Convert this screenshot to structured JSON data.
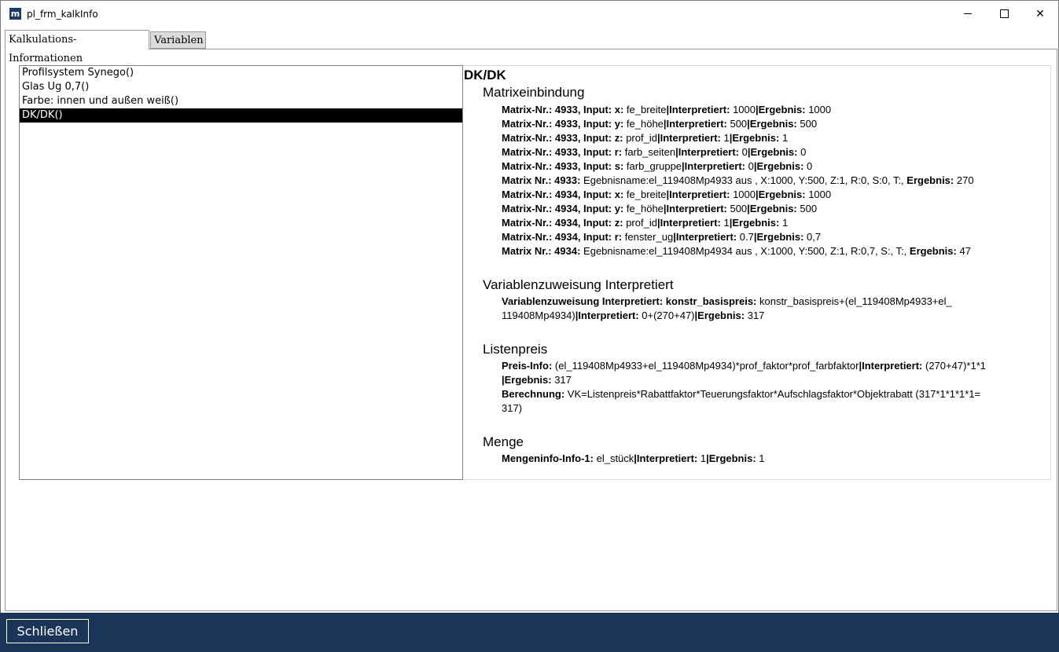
{
  "window": {
    "title": "pl_frm_kalkInfo",
    "icon_text": "m"
  },
  "tabs": [
    {
      "label": "Kalkulations-Informationen",
      "active": true
    },
    {
      "label": "Variablen",
      "active": false
    }
  ],
  "list": {
    "items": [
      "Profilsystem Synego()",
      "Glas Ug 0,7()",
      "Farbe: innen und außen weiß()",
      "DK/DK()"
    ],
    "selected_index": 3
  },
  "detail": {
    "title": "DK/DK",
    "sections": [
      {
        "heading": "Matrixeinbindung",
        "lines": [
          [
            "Matrix-Nr.: 4933, Input: x:",
            " fe_breite",
            "|Interpretiert:",
            " 1000",
            "|Ergebnis:",
            " 1000"
          ],
          [
            "Matrix-Nr.: 4933, Input: y:",
            " fe_höhe",
            "|Interpretiert:",
            " 500",
            "|Ergebnis:",
            " 500"
          ],
          [
            "Matrix-Nr.: 4933, Input: z:",
            " prof_id",
            "|Interpretiert:",
            " 1",
            "|Ergebnis:",
            " 1"
          ],
          [
            "Matrix-Nr.: 4933, Input: r:",
            " farb_seiten",
            "|Interpretiert:",
            " 0",
            "|Ergebnis:",
            " 0"
          ],
          [
            "Matrix-Nr.: 4933, Input: s:",
            " farb_gruppe",
            "|Interpretiert:",
            " 0",
            "|Ergebnis:",
            " 0"
          ],
          [
            "Matrix Nr.: 4933:",
            " Egebnisname:el_119408Mp4933 aus , X:1000, Y:500, Z:1, R:0, S:0, T:,",
            " Ergebnis:",
            " 270",
            "",
            ""
          ],
          [
            "Matrix-Nr.: 4934, Input: x:",
            " fe_breite",
            "|Interpretiert:",
            " 1000",
            "|Ergebnis:",
            " 1000"
          ],
          [
            "Matrix-Nr.: 4934, Input: y:",
            " fe_höhe",
            "|Interpretiert:",
            " 500",
            "|Ergebnis:",
            " 500"
          ],
          [
            "Matrix-Nr.: 4934, Input: z:",
            " prof_id",
            "|Interpretiert:",
            " 1",
            "|Ergebnis:",
            " 1"
          ],
          [
            "Matrix-Nr.: 4934, Input: r:",
            " fenster_ug",
            "|Interpretiert:",
            " 0.7",
            "|Ergebnis:",
            " 0,7"
          ],
          [
            "Matrix Nr.: 4934:",
            " Egebnisname:el_119408Mp4934 aus , X:1000, Y:500, Z:1, R:0,7, S:, T:,",
            " Ergebnis:",
            " 47",
            "",
            ""
          ]
        ]
      },
      {
        "heading": "Variablenzuweisung Interpretiert",
        "lines": [
          [
            "Variablenzuweisung Interpretiert: konstr_basispreis:",
            " konstr_basispreis+(el_119408Mp4933+el_",
            "",
            "",
            "",
            ""
          ],
          [
            "",
            "119408Mp4934)",
            "|Interpretiert:",
            " 0+(270+47)",
            "|Ergebnis:",
            " 317"
          ]
        ]
      },
      {
        "heading": "Listenpreis",
        "lines": [
          [
            "Preis-Info:",
            " (el_119408Mp4933+el_119408Mp4934)*prof_faktor*prof_farbfaktor",
            "|Interpretiert:",
            " (270+47)*1*1",
            "",
            ""
          ],
          [
            "",
            "",
            "|Ergebnis:",
            " 317",
            "",
            ""
          ],
          [
            "Berechnung:",
            " VK=Listenpreis*Rabattfaktor*Teuerungsfaktor*Aufschlagsfaktor*Objektrabatt (317*1*1*1*1=",
            "",
            "",
            "",
            ""
          ],
          [
            "",
            "317)",
            "",
            "",
            "",
            ""
          ]
        ]
      },
      {
        "heading": "Menge",
        "lines": [
          [
            "Mengeninfo-Info-1:",
            " el_stück",
            "|Interpretiert:",
            " 1",
            "|Ergebnis:",
            " 1"
          ]
        ]
      }
    ]
  },
  "footer": {
    "close_label": "Schließen"
  }
}
